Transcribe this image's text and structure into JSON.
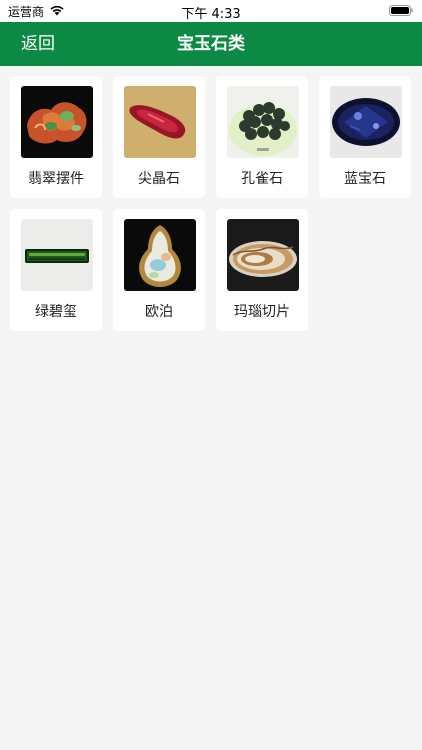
{
  "status_bar": {
    "carrier": "运营商",
    "time": "下午 4:33",
    "icons": [
      "wifi-icon",
      "battery-icon"
    ]
  },
  "nav": {
    "back_label": "返回",
    "title": "宝玉石类",
    "background_color": "#0c8a45"
  },
  "items": [
    {
      "label": "翡翠摆件",
      "image": "jadeite-ornament-photo"
    },
    {
      "label": "尖晶石",
      "image": "spinel-photo"
    },
    {
      "label": "孔雀石",
      "image": "malachite-photo"
    },
    {
      "label": "蓝宝石",
      "image": "sapphire-photo"
    },
    {
      "label": "绿碧玺",
      "image": "green-tourmaline-photo"
    },
    {
      "label": "欧泊",
      "image": "opal-photo"
    },
    {
      "label": "玛瑙切片",
      "image": "agate-slice-photo"
    }
  ]
}
